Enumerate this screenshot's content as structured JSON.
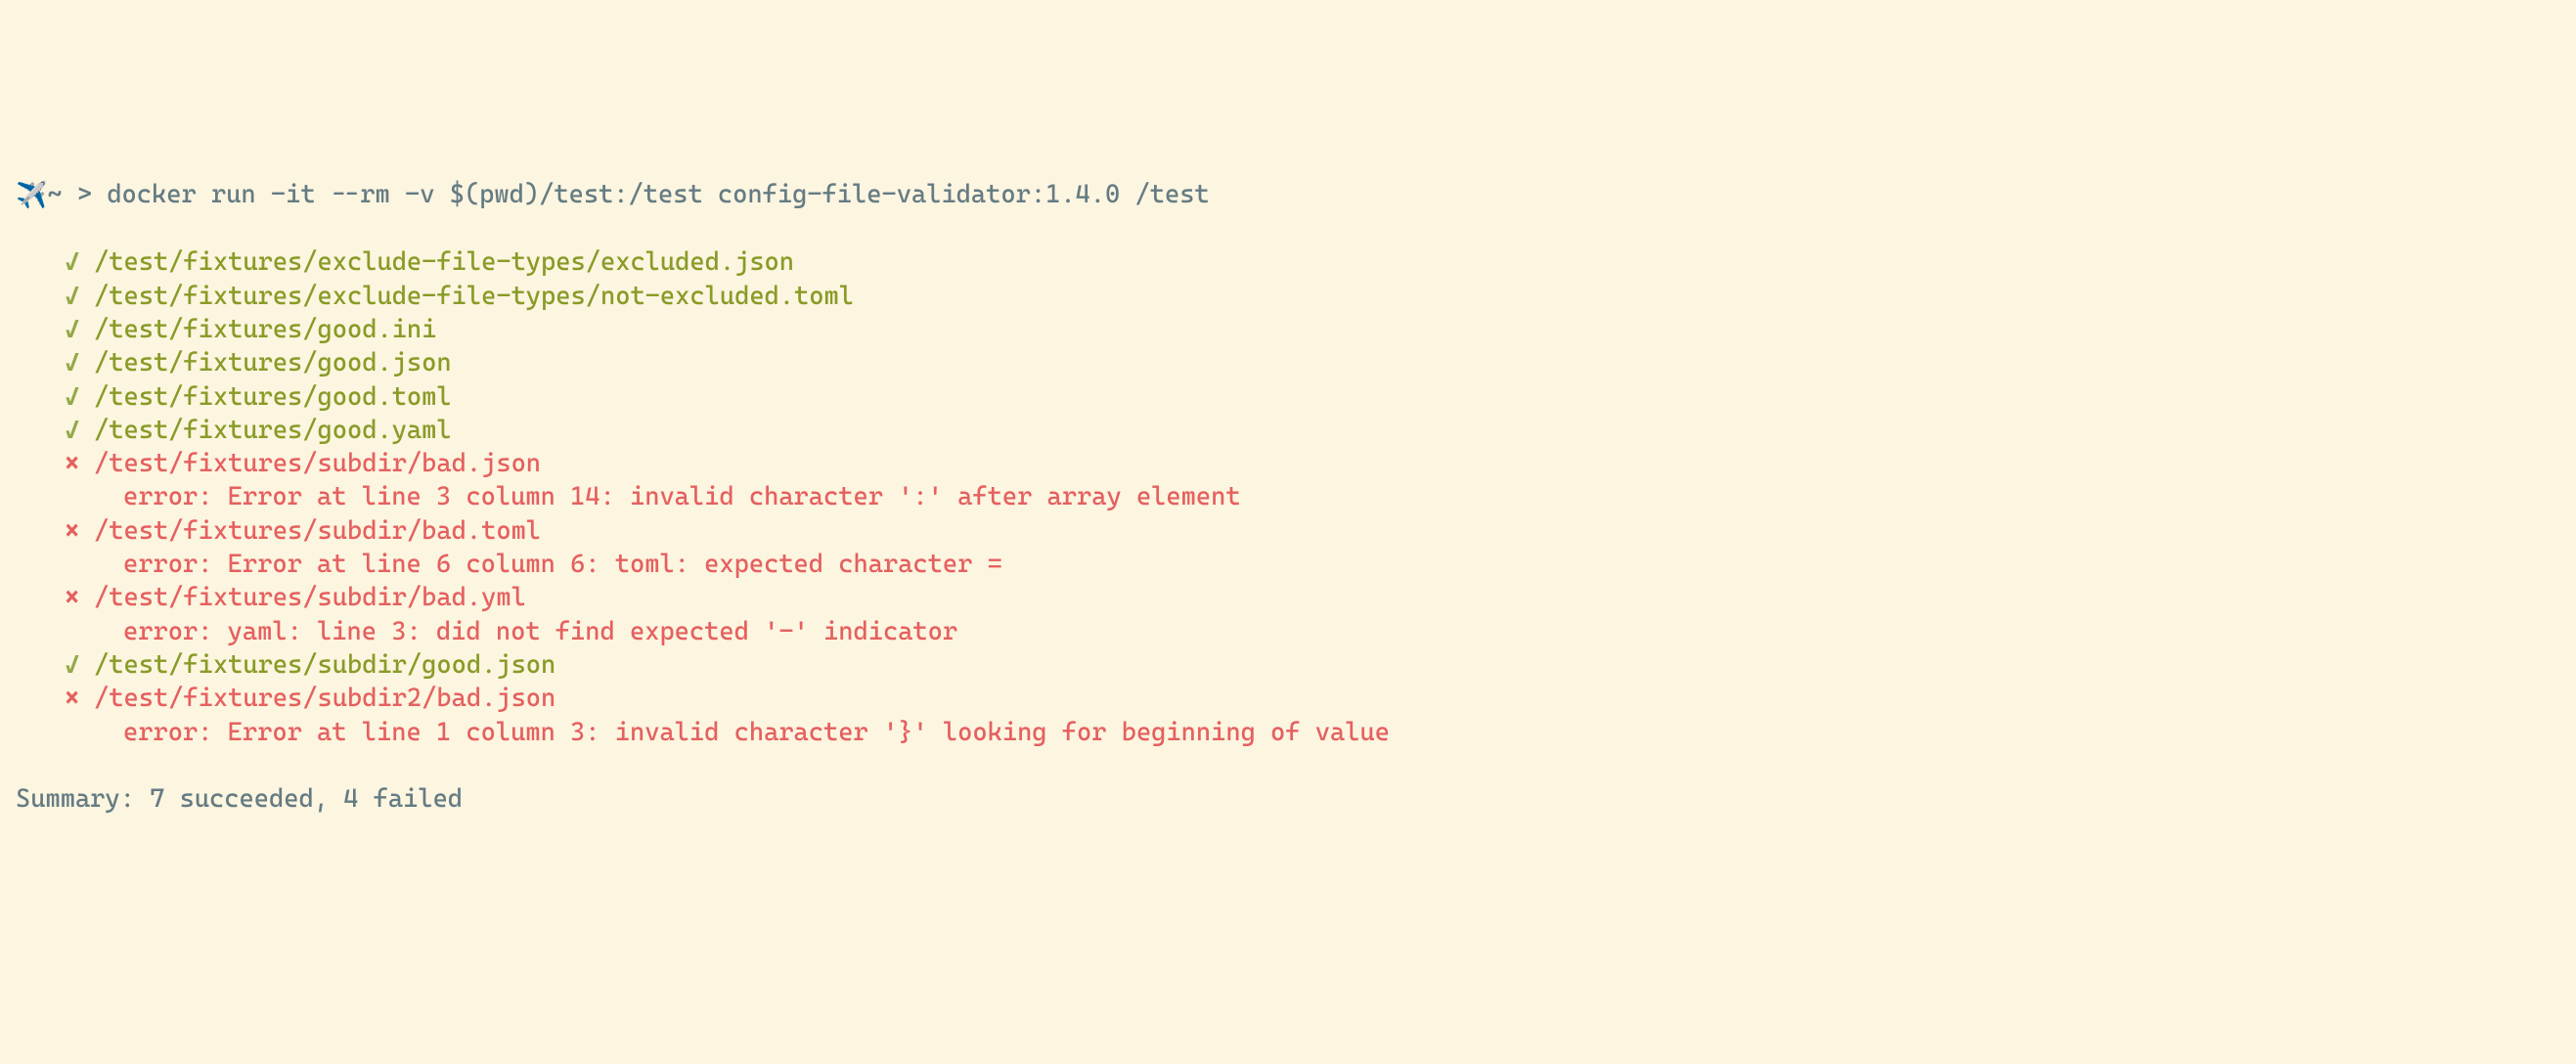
{
  "prompt": {
    "icon": "✈️",
    "path_prefix": "~ > ",
    "command": "docker run -it --rm -v $(pwd)/test:/test config-file-validator:1.4.0 /test"
  },
  "results": [
    {
      "status": "pass",
      "path": "/test/fixtures/exclude-file-types/excluded.json"
    },
    {
      "status": "pass",
      "path": "/test/fixtures/exclude-file-types/not-excluded.toml"
    },
    {
      "status": "pass",
      "path": "/test/fixtures/good.ini"
    },
    {
      "status": "pass",
      "path": "/test/fixtures/good.json"
    },
    {
      "status": "pass",
      "path": "/test/fixtures/good.toml"
    },
    {
      "status": "pass",
      "path": "/test/fixtures/good.yaml"
    },
    {
      "status": "fail",
      "path": "/test/fixtures/subdir/bad.json",
      "error": "error: Error at line 3 column 14: invalid character ':' after array element"
    },
    {
      "status": "fail",
      "path": "/test/fixtures/subdir/bad.toml",
      "error": "error: Error at line 6 column 6: toml: expected character ="
    },
    {
      "status": "fail",
      "path": "/test/fixtures/subdir/bad.yml",
      "error": "error: yaml: line 3: did not find expected '-' indicator"
    },
    {
      "status": "pass",
      "path": "/test/fixtures/subdir/good.json"
    },
    {
      "status": "fail",
      "path": "/test/fixtures/subdir2/bad.json",
      "error": "error: Error at line 1 column 3: invalid character '}' looking for beginning of value"
    }
  ],
  "summary": "Summary: 7 succeeded, 4 failed",
  "icons": {
    "check": "✓",
    "cross": "×"
  }
}
